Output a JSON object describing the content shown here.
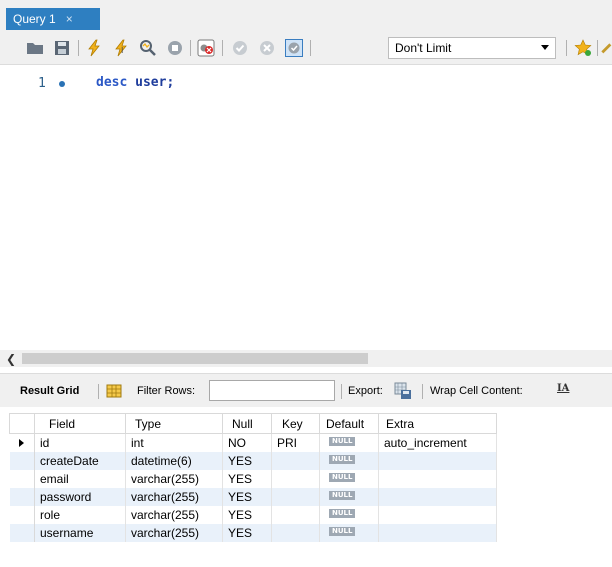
{
  "tab": {
    "title": "Query 1",
    "close": "×"
  },
  "toolbar": {
    "limit_value": "Don't Limit"
  },
  "editor": {
    "line_number": "1",
    "code_keyword": "desc",
    "code_rest": "user;"
  },
  "results": {
    "result_grid_label": "Result Grid",
    "filter_label": "Filter Rows:",
    "export_label": "Export:",
    "wrap_label": "Wrap Cell Content:",
    "null_label": "NULL",
    "columns": [
      "Field",
      "Type",
      "Null",
      "Key",
      "Default",
      "Extra"
    ],
    "rows": [
      {
        "field": "id",
        "type": "int",
        "null": "NO",
        "key": "PRI",
        "default_null": true,
        "extra": "auto_increment"
      },
      {
        "field": "createDate",
        "type": "datetime(6)",
        "null": "YES",
        "key": "",
        "default_null": true,
        "extra": ""
      },
      {
        "field": "email",
        "type": "varchar(255)",
        "null": "YES",
        "key": "",
        "default_null": true,
        "extra": ""
      },
      {
        "field": "password",
        "type": "varchar(255)",
        "null": "YES",
        "key": "",
        "default_null": true,
        "extra": ""
      },
      {
        "field": "role",
        "type": "varchar(255)",
        "null": "YES",
        "key": "",
        "default_null": true,
        "extra": ""
      },
      {
        "field": "username",
        "type": "varchar(255)",
        "null": "YES",
        "key": "",
        "default_null": true,
        "extra": ""
      }
    ]
  }
}
